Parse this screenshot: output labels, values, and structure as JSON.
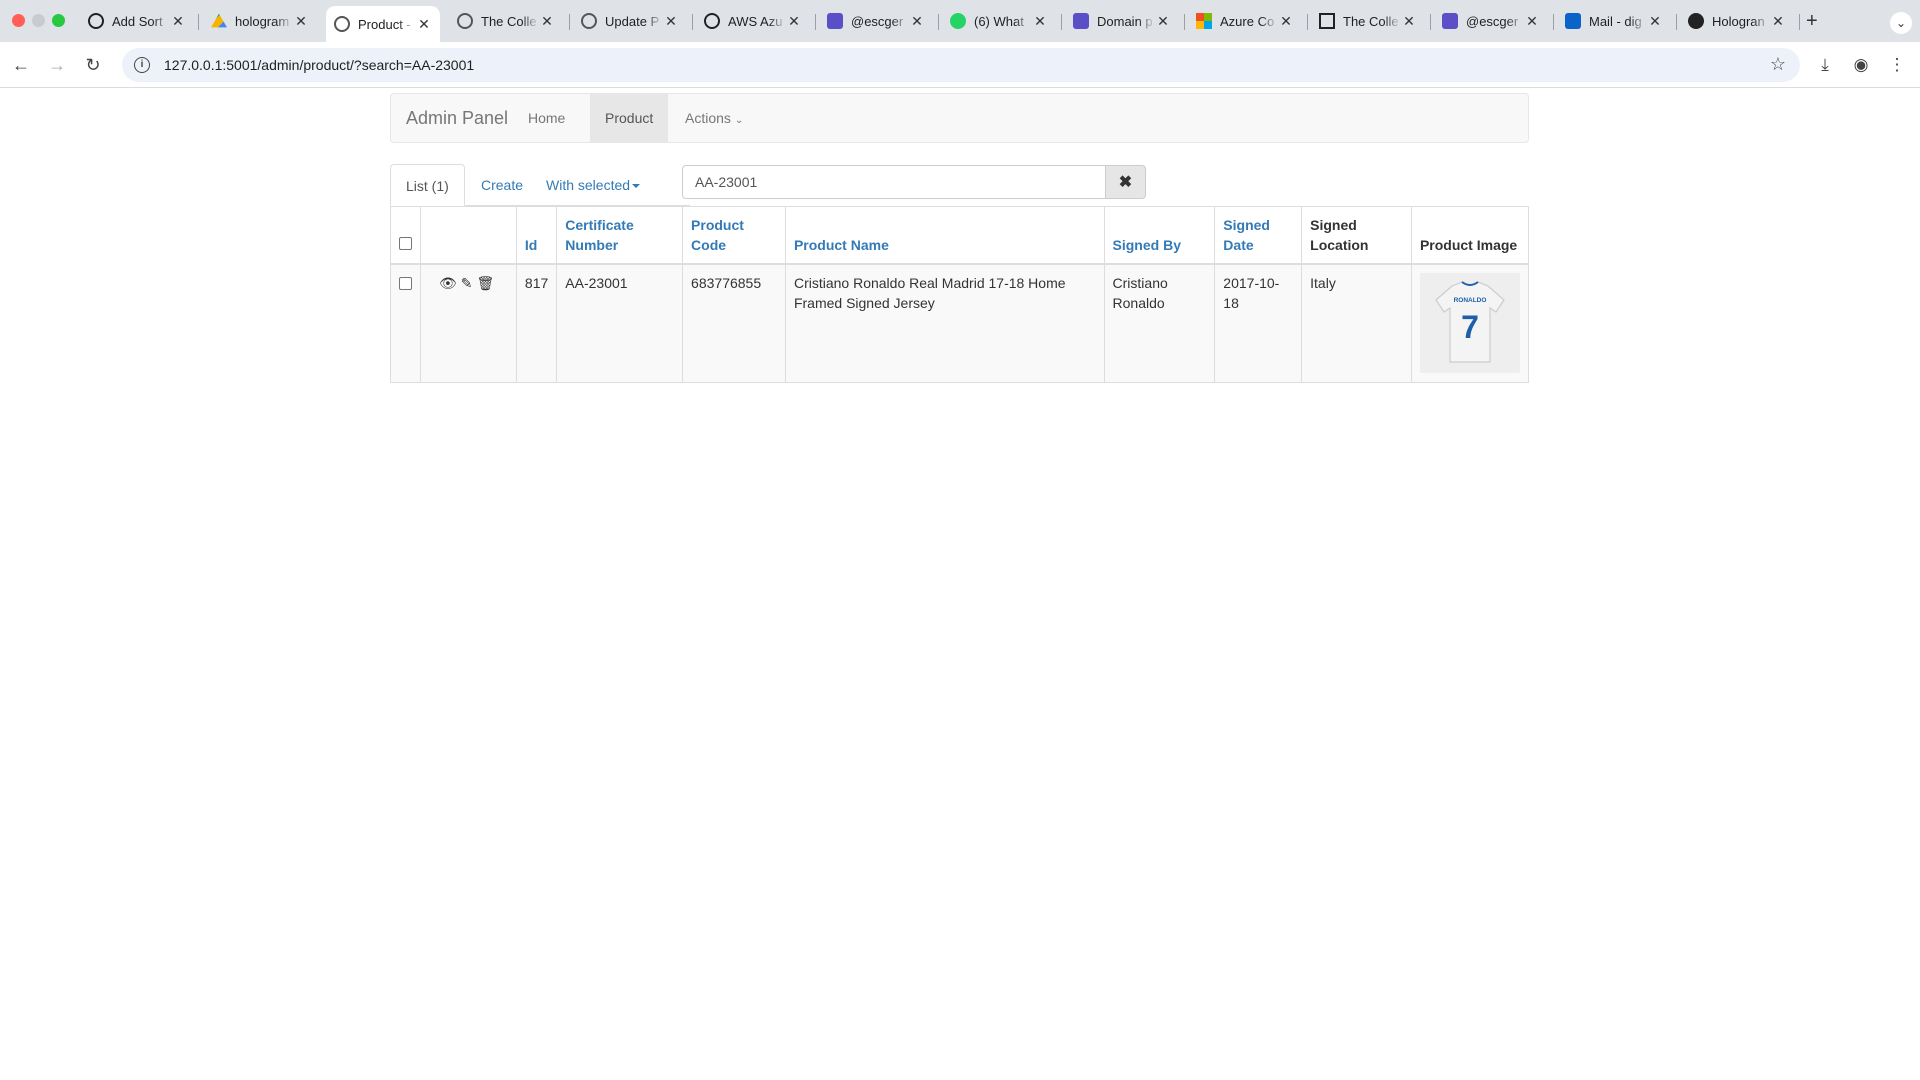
{
  "browser": {
    "tabs": [
      {
        "title": "Add Sort",
        "icon": "openai-icon",
        "active": false
      },
      {
        "title": "hologram",
        "icon": "google-drive-icon",
        "active": false
      },
      {
        "title": "Product -",
        "icon": "globe-icon",
        "active": true
      },
      {
        "title": "The Colle",
        "icon": "globe-icon",
        "active": false
      },
      {
        "title": "Update P",
        "icon": "globe-icon",
        "active": false
      },
      {
        "title": "AWS Azu",
        "icon": "openai-icon",
        "active": false
      },
      {
        "title": "@escger",
        "icon": "escrow-icon",
        "active": false
      },
      {
        "title": "(6) What",
        "icon": "whatsapp-icon",
        "active": false
      },
      {
        "title": "Domain p",
        "icon": "escrow-icon",
        "active": false
      },
      {
        "title": "Azure Co",
        "icon": "microsoft-icon",
        "active": false
      },
      {
        "title": "The Colle",
        "icon": "collection-icon",
        "active": false
      },
      {
        "title": "@escger",
        "icon": "escrow-icon",
        "active": false
      },
      {
        "title": "Mail - dig",
        "icon": "outlook-icon",
        "active": false
      },
      {
        "title": "Hologran",
        "icon": "github-icon",
        "active": false
      }
    ],
    "url": "127.0.0.1:5001/admin/product/?search=AA-23001"
  },
  "navbar": {
    "brand": "Admin Panel",
    "items": [
      {
        "label": "Home",
        "active": false
      },
      {
        "label": "Product",
        "active": true
      },
      {
        "label": "Actions",
        "active": false
      }
    ]
  },
  "tabs": {
    "list": "List (1)",
    "create": "Create",
    "with_selected": "With selected"
  },
  "search": {
    "value": "AA-23001",
    "clear_icon": "✖"
  },
  "table": {
    "columns": {
      "id": "Id",
      "certificate_number": "Certificate Number",
      "product_code": "Product Code",
      "product_name": "Product Name",
      "signed_by": "Signed By",
      "signed_date": "Signed Date",
      "signed_location": "Signed Location",
      "product_image": "Product Image"
    },
    "rows": [
      {
        "id": "817",
        "certificate_number": "AA-23001",
        "product_code": "683776855",
        "product_name": "Cristiano Ronaldo Real Madrid 17-18 Home Framed Signed Jersey",
        "signed_by": "Cristiano Ronaldo",
        "signed_date": "2017-10-18",
        "signed_location": "Italy",
        "image_text_name": "RONALDO",
        "image_text_number": "7"
      }
    ]
  },
  "colors": {
    "link": "#337ab7",
    "navbar_bg": "#f8f8f8",
    "active_nav": "#e7e7e7"
  }
}
